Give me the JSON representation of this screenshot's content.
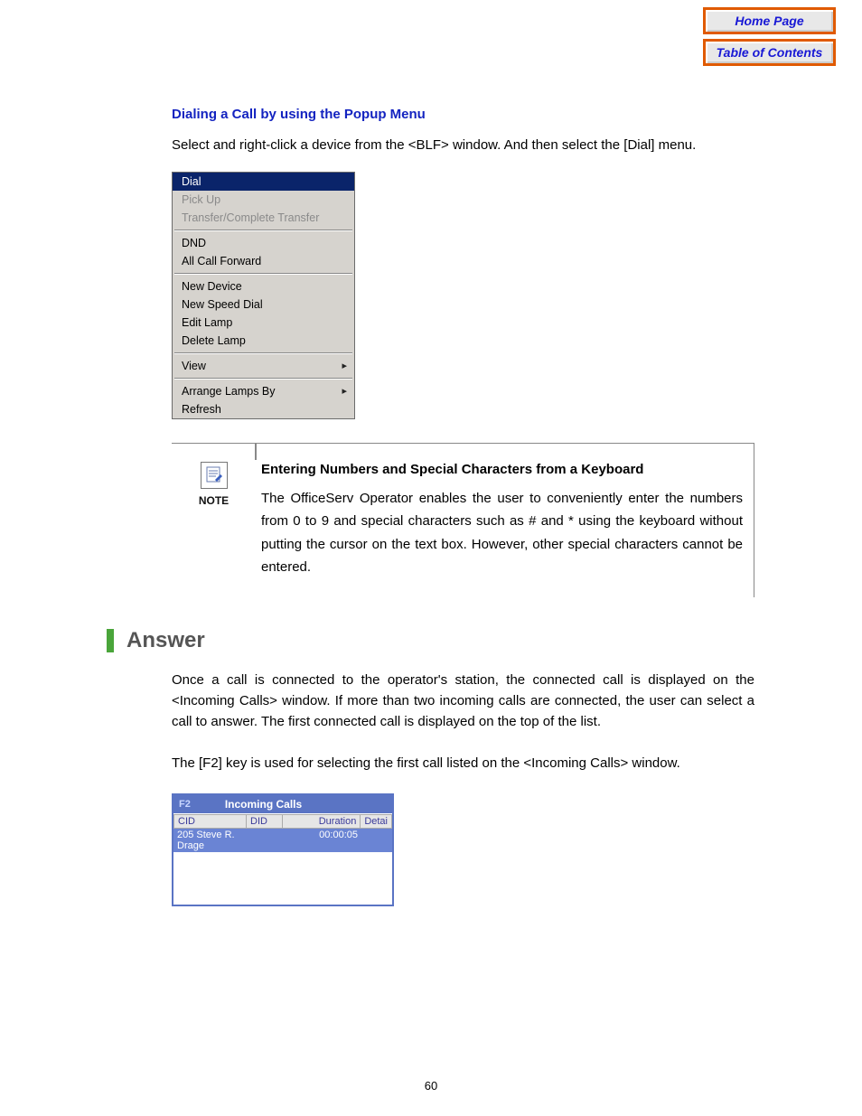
{
  "nav": {
    "home": "Home Page",
    "toc": "Table of Contents"
  },
  "section1": {
    "heading": "Dialing a Call by using the Popup Menu",
    "intro": "Select and right-click a device from the <BLF> window. And then select the [Dial] menu."
  },
  "popup": {
    "items": [
      {
        "label": "Dial",
        "state": "selected"
      },
      {
        "label": "Pick Up",
        "state": "disabled"
      },
      {
        "label": "Transfer/Complete Transfer",
        "state": "disabled"
      }
    ],
    "group2": [
      {
        "label": "DND"
      },
      {
        "label": "All Call Forward"
      }
    ],
    "group3": [
      {
        "label": "New Device"
      },
      {
        "label": "New Speed Dial"
      },
      {
        "label": "Edit Lamp"
      },
      {
        "label": "Delete Lamp"
      }
    ],
    "group4": [
      {
        "label": "View",
        "arrow": true
      }
    ],
    "group5": [
      {
        "label": "Arrange Lamps By",
        "arrow": true
      },
      {
        "label": "Refresh"
      }
    ]
  },
  "note": {
    "label": "NOTE",
    "title": "Entering Numbers and Special Characters from a Keyboard",
    "body": "The OfficeServ Operator enables the user to conveniently enter the numbers from 0 to 9 and special characters such as # and * using the keyboard without putting the cursor on the text box. However, other special characters cannot be entered."
  },
  "answer": {
    "heading": "Answer",
    "p1": "Once a call is connected to the operator's station, the connected call is displayed on the <Incoming Calls> window. If more than two incoming calls are connected, the user can select a call to answer. The first connected call is displayed on the top of the list.",
    "p2": "The [F2] key is used for selecting the first call listed on the <Incoming Calls> window."
  },
  "incoming": {
    "f2": "F2",
    "title": "Incoming Calls",
    "cols": {
      "cid": "CID",
      "did": "DID",
      "duration": "Duration",
      "detail": "Detai"
    },
    "row": {
      "cid": "205 Steve R. Drage",
      "did": "",
      "duration": "00:00:05",
      "detail": ""
    }
  },
  "page_number": "60"
}
